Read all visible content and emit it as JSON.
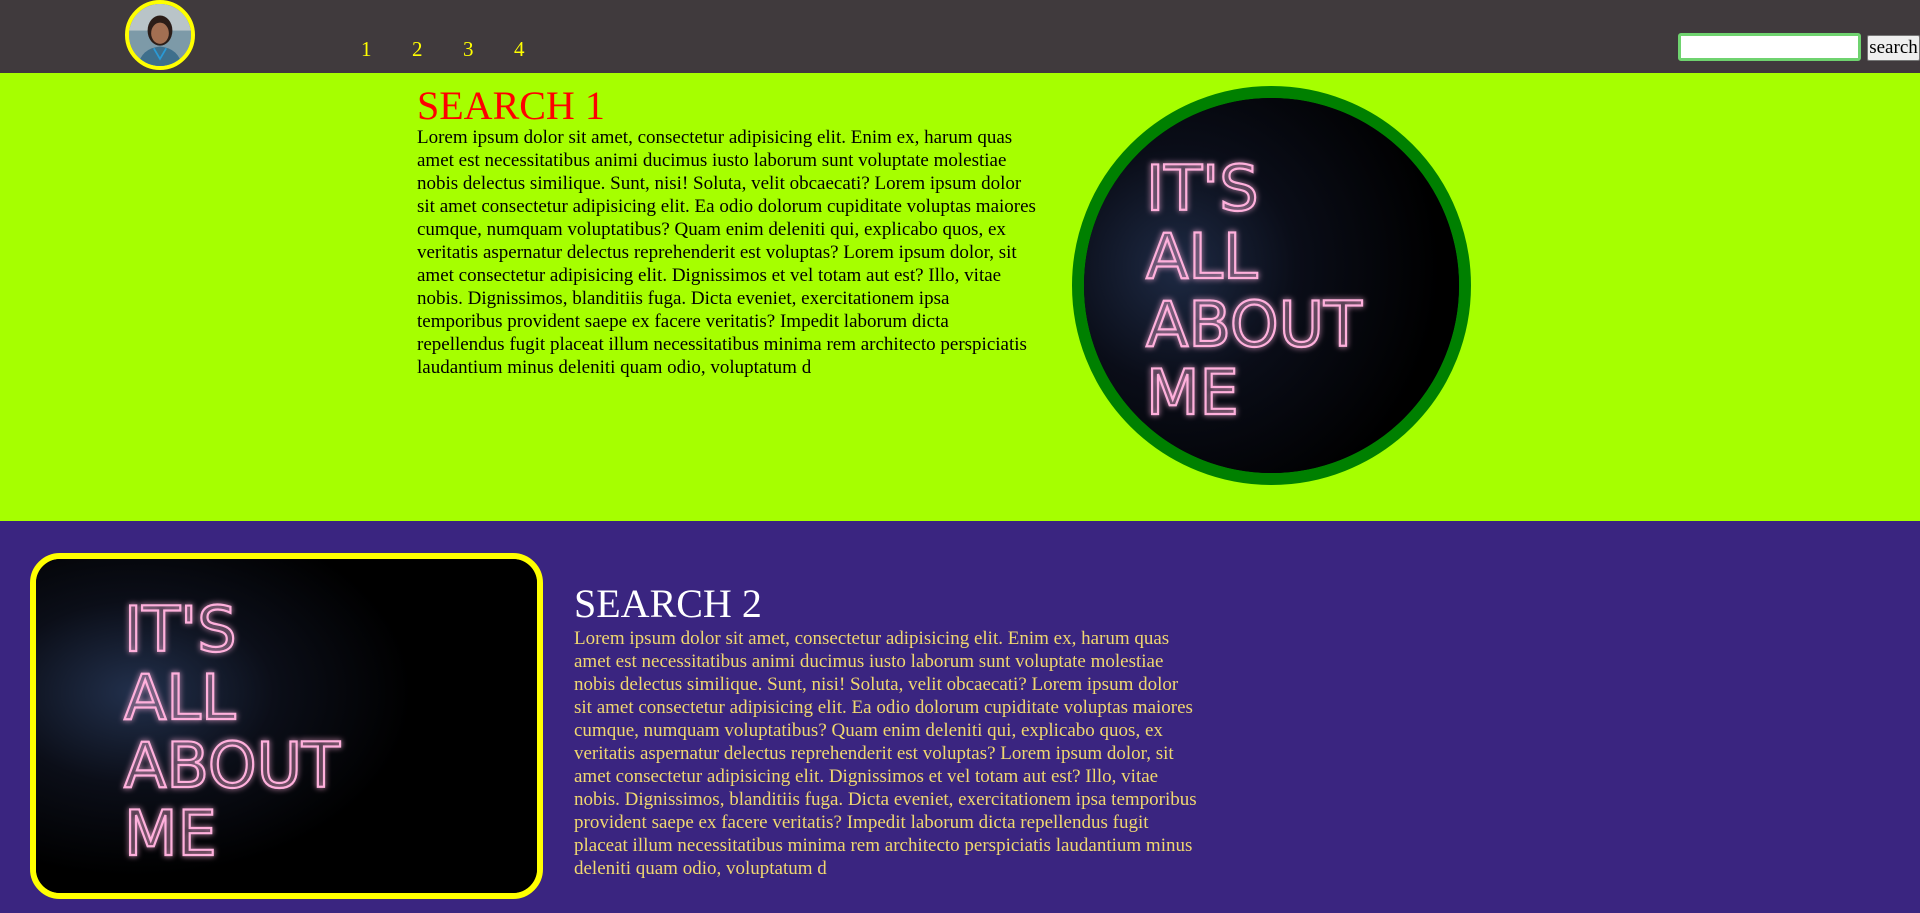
{
  "navbar": {
    "avatar_alt": "profile photo",
    "links": [
      "1",
      "2",
      "3",
      "4"
    ],
    "search": {
      "value": "",
      "placeholder": "",
      "button_label": "search"
    }
  },
  "section1": {
    "title": "SEARCH 1",
    "text": "Lorem ipsum dolor sit amet, consectetur adipisicing elit. Enim ex, harum quas amet est necessitatibus animi ducimus iusto laborum sunt voluptate molestiae nobis delectus similique. Sunt, nisi! Soluta, velit obcaecati? Lorem ipsum dolor sit amet consectetur adipisicing elit. Ea odio dolorum cupiditate voluptas maiores cumque, numquam voluptatibus? Quam enim deleniti qui, explicabo quos, ex veritatis aspernatur delectus reprehenderit est voluptas? Lorem ipsum dolor, sit amet consectetur adipisicing elit. Dignissimos et vel totam aut est? Illo, vitae nobis. Dignissimos, blanditiis fuga. Dicta eveniet, exercitationem ipsa temporibus provident saepe ex facere veritatis? Impedit laborum dicta repellendus fugit placeat illum necessitatibus minima rem architecto perspiciatis laudantium minus deleniti quam odio, voluptatum d",
    "image_text": [
      "IT'S",
      "ALL",
      "ABOUT",
      "ME"
    ]
  },
  "section2": {
    "title": "SEARCH 2",
    "text": "Lorem ipsum dolor sit amet, consectetur adipisicing elit. Enim ex, harum quas amet est necessitatibus animi ducimus iusto laborum sunt voluptate molestiae nobis delectus similique. Sunt, nisi! Soluta, velit obcaecati? Lorem ipsum dolor sit amet consectetur adipisicing elit. Ea odio dolorum cupiditate voluptas maiores cumque, numquam voluptatibus? Quam enim deleniti qui, explicabo quos, ex veritatis aspernatur delectus reprehenderit est voluptas? Lorem ipsum dolor, sit amet consectetur adipisicing elit. Dignissimos et vel totam aut est? Illo, vitae nobis. Dignissimos, blanditiis fuga. Dicta eveniet, exercitationem ipsa temporibus provident saepe ex facere veritatis? Impedit laborum dicta repellendus fugit placeat illum necessitatibus minima rem architecto perspiciatis laudantium minus deleniti quam odio, voluptatum d",
    "image_text": [
      "IT'S",
      "ALL",
      "ABOUT",
      "ME"
    ]
  },
  "colors": {
    "navbar_bg": "#403a3d",
    "nav_link": "#ffff00",
    "section1_bg": "#a6ff00",
    "section1_title": "#ff0000",
    "section1_image_border": "#008000",
    "section2_bg": "#3a2580",
    "section2_title": "#ffffff",
    "section2_text": "#f0d770",
    "section2_image_border": "#ffff00",
    "neon_pink": "#ff8fd0"
  }
}
